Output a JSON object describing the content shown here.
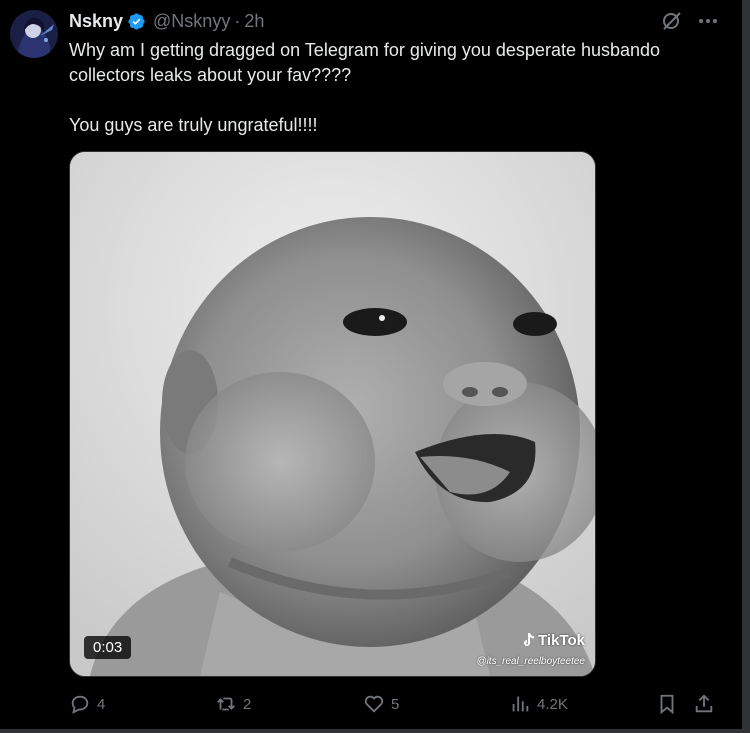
{
  "post": {
    "display_name": "Nskny",
    "handle": "@Nsknyy",
    "separator": "·",
    "time": "2h",
    "text_line1": "Why am I getting dragged on Telegram for giving you desperate husbando collectors leaks about your fav????",
    "text_line2": "You guys are truly ungrateful!!!!"
  },
  "media": {
    "duration": "0:03",
    "watermark": "TikTok",
    "watermark_user": "@its_real_reelboyteetee"
  },
  "actions": {
    "replies": "4",
    "reposts": "2",
    "likes": "5",
    "views": "4.2K"
  },
  "icons": {
    "verified": "verified-badge-icon",
    "grok": "grok-icon",
    "more": "more-icon",
    "reply": "reply-icon",
    "repost": "repost-icon",
    "like": "heart-icon",
    "views": "views-icon",
    "bookmark": "bookmark-icon",
    "share": "share-icon"
  },
  "colors": {
    "background": "#000000",
    "text": "#e7e9ea",
    "muted": "#71767b",
    "verified": "#1d9bf0"
  }
}
